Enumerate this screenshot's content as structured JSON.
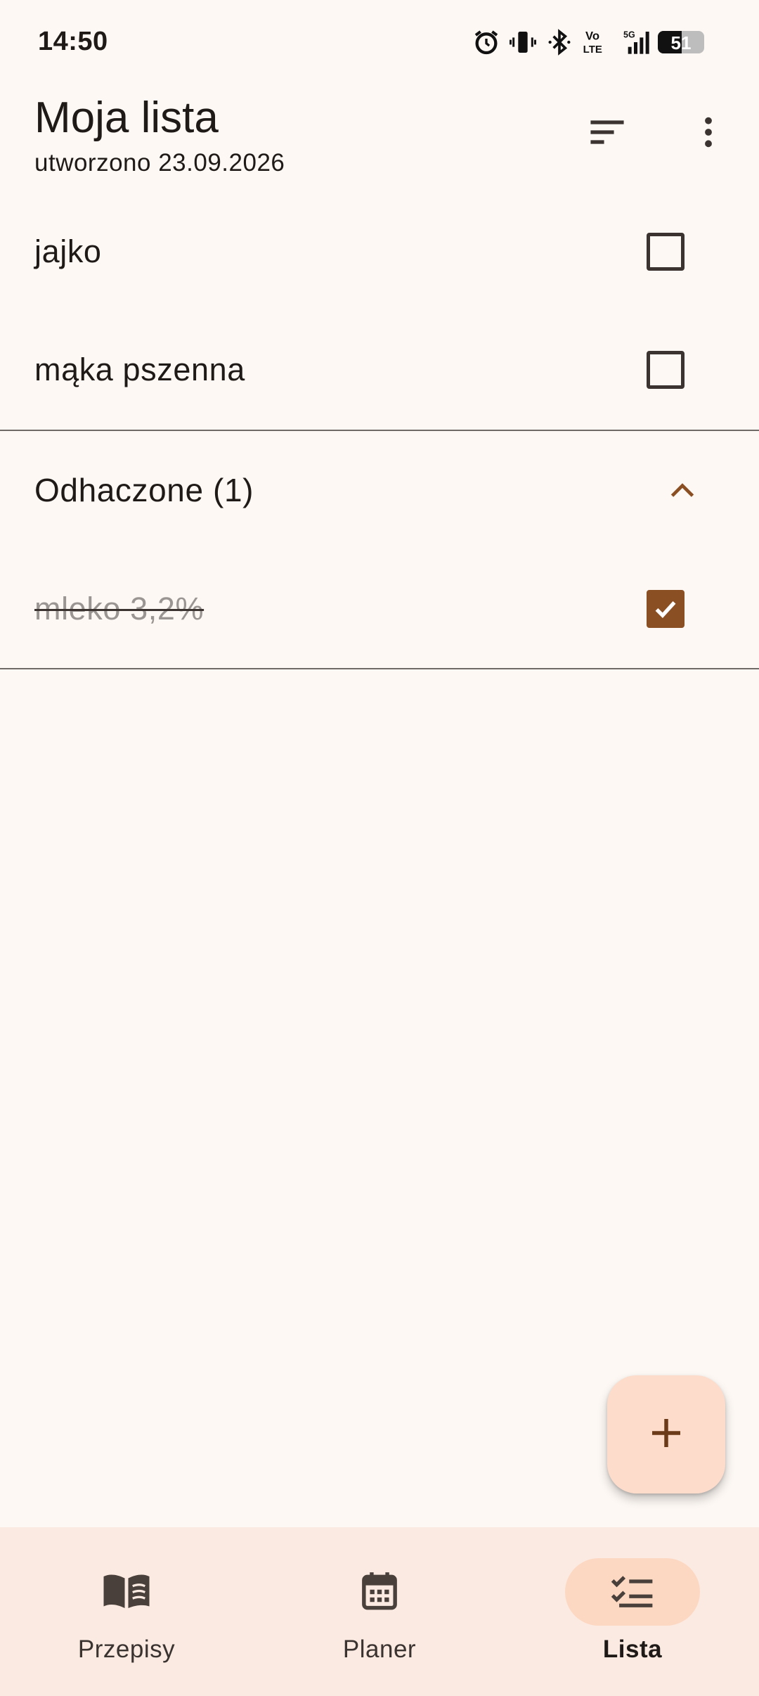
{
  "status_bar": {
    "time": "14:50",
    "icons": [
      "alarm-icon",
      "vibrate-icon",
      "bluetooth-icon",
      "volte-icon",
      "signal-5g-icon",
      "battery-icon"
    ],
    "volte_label_top": "Vo",
    "volte_label_bottom": "LTE",
    "network_label": "5G",
    "battery_percent": "51",
    "battery_level": 0.51
  },
  "app_bar": {
    "title": "Moja lista",
    "subtitle": "utworzono 23.09.2026",
    "actions": [
      "sort-icon",
      "more-vert-icon"
    ]
  },
  "items": [
    {
      "label": "jajko",
      "checked": false
    },
    {
      "label": "mąka pszenna",
      "checked": false
    }
  ],
  "checked_section": {
    "title": "Odhaczone (1)",
    "expanded": true,
    "items": [
      {
        "label": "mleko 3,2%",
        "checked": true
      }
    ]
  },
  "fab": {
    "icon": "add-icon"
  },
  "bottom_nav": {
    "items": [
      {
        "label": "Przepisy",
        "icon": "book-icon",
        "active": false
      },
      {
        "label": "Planer",
        "icon": "calendar-icon",
        "active": false
      },
      {
        "label": "Lista",
        "icon": "checklist-icon",
        "active": true
      }
    ]
  },
  "colors": {
    "background": "#fdf8f4",
    "accent": "#8b4f24",
    "fab_background": "#fddccb",
    "nav_background": "#fbeae1",
    "nav_indicator": "#fcd8c3"
  }
}
